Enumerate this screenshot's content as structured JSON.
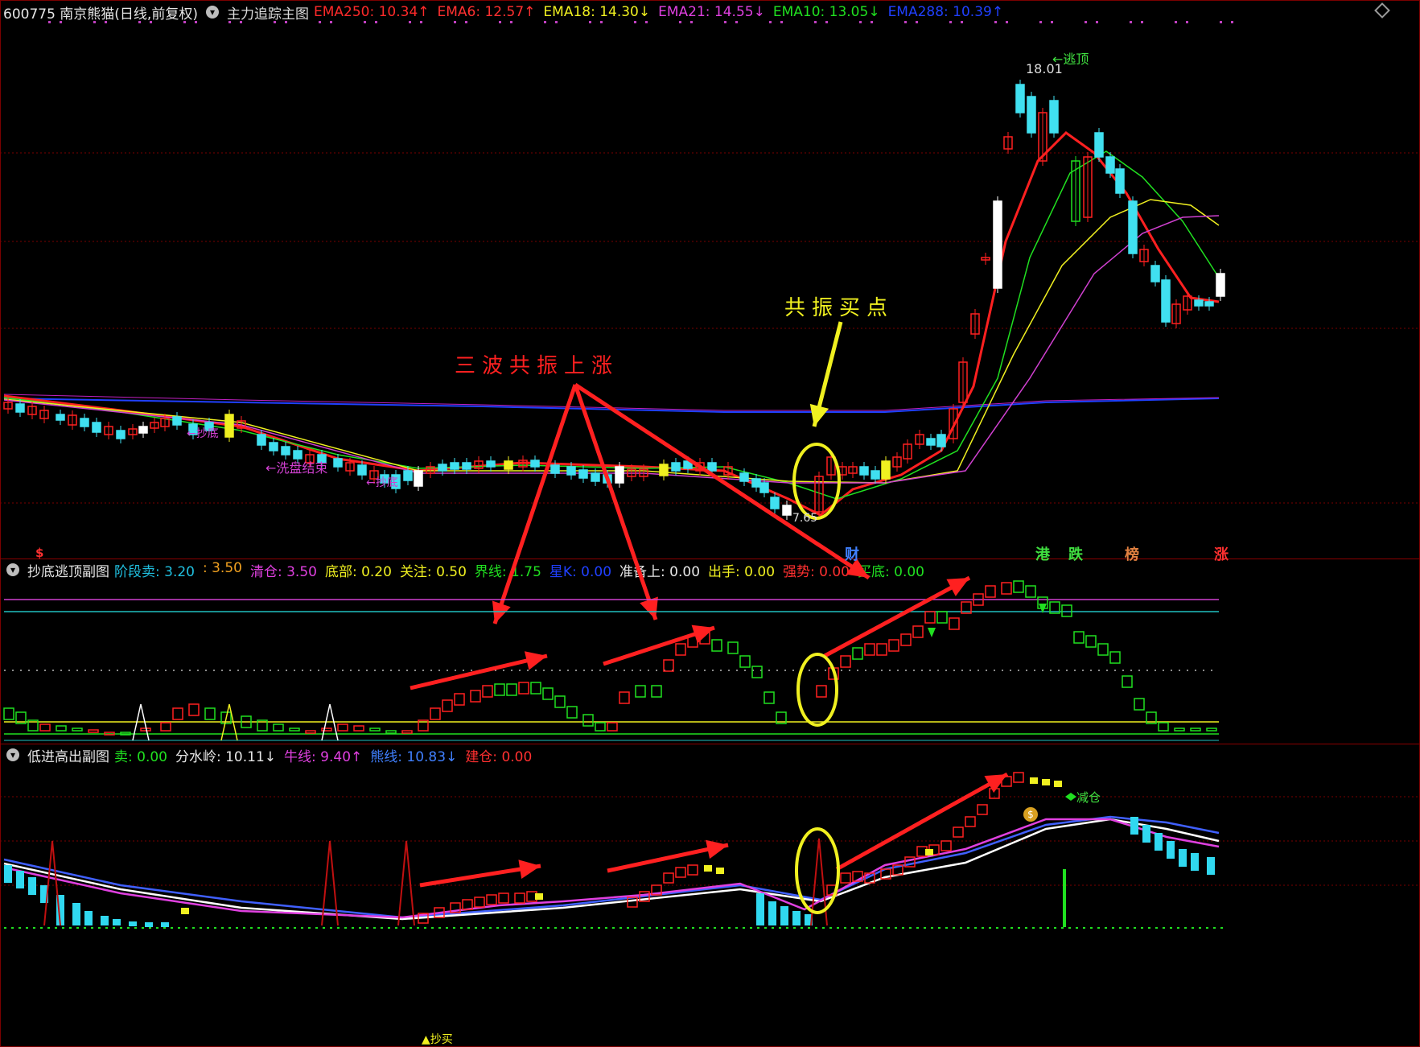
{
  "main_chart": {
    "title": "600775 南京熊猫(日线,前复权)",
    "indicator_name": "主力追踪主图",
    "ema": [
      {
        "label": "EMA250: 10.34",
        "arrow": "↑",
        "color": "#ff2a2a"
      },
      {
        "label": "EMA6: 12.57",
        "arrow": "↑",
        "color": "#ff3030"
      },
      {
        "label": "EMA18: 14.30",
        "arrow": "↓",
        "color": "#f0f020"
      },
      {
        "label": "EMA21: 14.55",
        "arrow": "↓",
        "color": "#e040e0"
      },
      {
        "label": "EMA10: 13.05",
        "arrow": "↓",
        "color": "#20e020"
      },
      {
        "label": "EMA288: 10.39",
        "arrow": "↑",
        "color": "#2040ff"
      }
    ],
    "high_label": "18.01",
    "low_label": "7.65",
    "escape_top_label": "←逃顶",
    "wash_end_label": "←洗盘结束",
    "buy_labels": [
      "←抄底",
      "←抄底",
      "←抄底"
    ],
    "event_tags": [
      {
        "text": "$",
        "color": "#ff3030"
      },
      {
        "text": "财",
        "color": "#4080ff"
      },
      {
        "text": "港",
        "color": "#40e040"
      },
      {
        "text": "跌",
        "color": "#40e040"
      },
      {
        "text": "榜",
        "color": "#e08040"
      },
      {
        "text": "涨",
        "color": "#ff3030"
      }
    ]
  },
  "annotations": {
    "three_wave": "三波共振上涨",
    "resonance_buy": "共振买点"
  },
  "sub1": {
    "name": "抄底逃顶副图",
    "items": [
      {
        "label": "阶段卖: 3.20",
        "color": "#20c0e0"
      },
      {
        "label": ": 3.50",
        "color": "#f0a020"
      },
      {
        "label": "清仓: 3.50",
        "color": "#e040e0"
      },
      {
        "label": "底部: 0.20",
        "color": "#f0f020"
      },
      {
        "label": "关注: 0.50",
        "color": "#f0f020"
      },
      {
        "label": "界线: 1.75",
        "color": "#20e020"
      },
      {
        "label": "星K: 0.00",
        "color": "#2040ff"
      },
      {
        "label": "准备上: 0.00",
        "color": "#e6e6e6"
      },
      {
        "label": "出手: 0.00",
        "color": "#f0f020"
      },
      {
        "label": "强势: 0.00",
        "color": "#ff3030"
      },
      {
        "label": "买底: 0.00",
        "color": "#20e020"
      }
    ]
  },
  "sub2": {
    "name": "低进高出副图",
    "items": [
      {
        "label": "卖: 0.00",
        "arrow": "",
        "color": "#20e020"
      },
      {
        "label": "分水岭: 10.11",
        "arrow": "↓",
        "color": "#e6e6e6"
      },
      {
        "label": "牛线: 9.40",
        "arrow": "↑",
        "color": "#e040e0"
      },
      {
        "label": "熊线: 10.83",
        "arrow": "↓",
        "color": "#4080ff"
      },
      {
        "label": "建仓: 0.00",
        "arrow": "",
        "color": "#ff3030"
      }
    ],
    "reduce_label": "减仓",
    "buy_label": "抄买",
    "money_icon": "$"
  }
}
